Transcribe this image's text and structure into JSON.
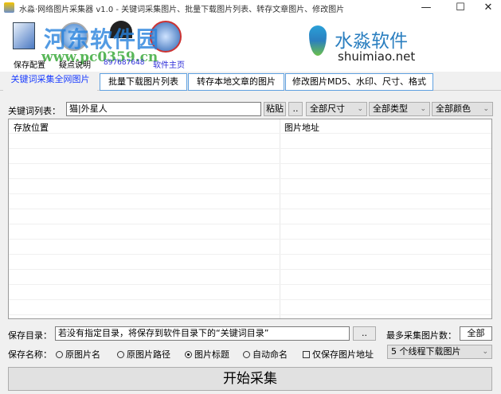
{
  "window": {
    "title": "水淼·网络图片采集器 v1.0 - 关键词采集图片、批量下载图片列表、转存文章图片、修改图片",
    "minimize": "—",
    "maximize": "☐",
    "close": "✕"
  },
  "watermark": {
    "name": "河东软件园",
    "url": "www.pc0359.cn"
  },
  "toolbar": {
    "items": [
      {
        "label": "保存配置",
        "icon": "save-icon"
      },
      {
        "label": "疑点说明",
        "icon": "help-icon"
      },
      {
        "label": "897687648",
        "icon": "qq-icon"
      },
      {
        "label": "软件主页",
        "icon": "globe-icon"
      }
    ]
  },
  "brand": {
    "name": "水淼软件",
    "url": "shuimiao.net"
  },
  "tabs": [
    {
      "label": "关键词采集全网图片",
      "active": true
    },
    {
      "label": "批量下载图片列表"
    },
    {
      "label": "转存本地文章的图片"
    },
    {
      "label": "修改图片MD5、水印、尺寸、格式"
    }
  ],
  "keyword": {
    "label": "关键词列表：",
    "value": "猫|外星人",
    "paste": "粘贴",
    "more": "..",
    "size": "全部尺寸",
    "type": "全部类型",
    "color": "全部颜色"
  },
  "table": {
    "columns": [
      "存放位置",
      "图片地址"
    ],
    "rows": []
  },
  "save": {
    "label": "保存目录：",
    "value": "若没有指定目录，将保存到软件目录下的“关键词目录”",
    "browse": "..",
    "max_label": "最多采集图片数：",
    "max_value": "全部"
  },
  "naming": {
    "label": "保存名称：",
    "options": [
      {
        "label": "原图片名",
        "checked": false
      },
      {
        "label": "原图片路径",
        "checked": false
      },
      {
        "label": "图片标题",
        "checked": true
      },
      {
        "label": "自动命名",
        "checked": false
      }
    ],
    "only_url": {
      "label": "仅保存图片地址",
      "checked": false
    },
    "threads": "5 个线程下载图片"
  },
  "start": "开始采集"
}
